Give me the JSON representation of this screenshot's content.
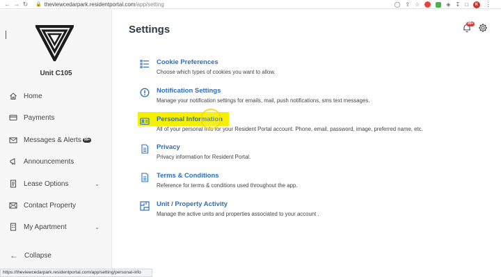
{
  "browser": {
    "url_domain": "theviewcedarpark.residentportal.com",
    "url_path": "/app/setting",
    "profile_initial": "K"
  },
  "sidebar": {
    "unit": "Unit C105",
    "items": [
      {
        "label": "Home",
        "icon": "home-icon"
      },
      {
        "label": "Payments",
        "icon": "credit-card-icon"
      },
      {
        "label": "Messages & Alerts",
        "icon": "envelope-icon",
        "badge": "99+"
      },
      {
        "label": "Announcements",
        "icon": "megaphone-icon"
      },
      {
        "label": "Lease Options",
        "icon": "document-icon",
        "expandable": true
      },
      {
        "label": "Contact Property",
        "icon": "mail-icon"
      },
      {
        "label": "My Apartment",
        "icon": "building-icon",
        "expandable": true
      }
    ],
    "collapse_label": "Collapse"
  },
  "header": {
    "title": "Settings",
    "notification_badge": "99+"
  },
  "settings": [
    {
      "title": "Cookie Preferences",
      "desc": "Choose which types of cookies you want to allow.",
      "icon": "list-icon"
    },
    {
      "title": "Notification Settings",
      "desc": "Manage your notification settings for emails, mail, push notifications, sms text messages.",
      "icon": "info-circle-icon"
    },
    {
      "title": "Personal Information",
      "desc": "All of your personal info for your Resident Portal account. Phone, email, password, image, preferred name, etc.",
      "icon": "id-card-icon"
    },
    {
      "title": "Privacy",
      "desc": "Privacy information for Resident Portal.",
      "icon": "document-icon"
    },
    {
      "title": "Terms & Conditions",
      "desc": "Reference for terms & conditions used throughout the app.",
      "icon": "document-icon"
    },
    {
      "title": "Unit / Property Activity",
      "desc": "Manage the active units and properties associated to your account .",
      "icon": "floorplan-icon"
    }
  ],
  "status_bar": "https://theviewcedarpark.residentportal.com/app/setting/personal-info",
  "colors": {
    "accent": "#2f6dbd",
    "highlight": "#f4f000",
    "badge": "#e53935"
  }
}
